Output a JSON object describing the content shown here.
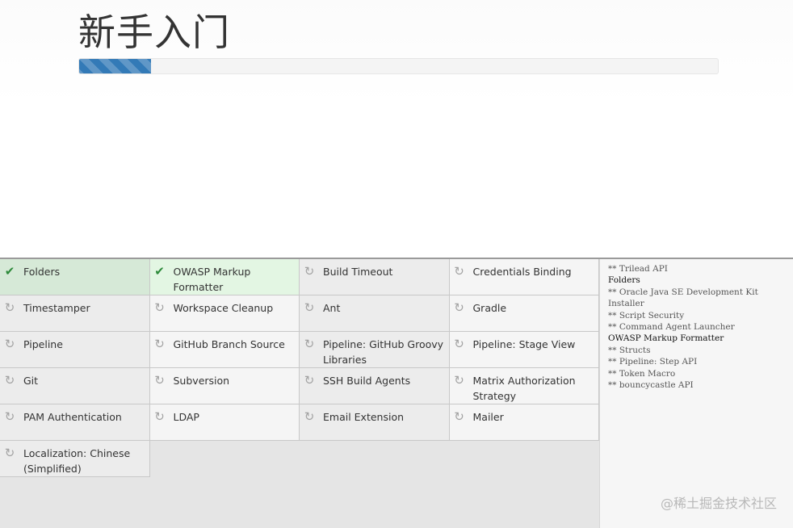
{
  "header": {
    "title": "新手入门",
    "progress_percent": 11.3
  },
  "plugin_rows": [
    [
      {
        "label": "Folders",
        "status": "success",
        "icon": "check-icon"
      },
      {
        "label": "OWASP Markup Formatter",
        "status": "success",
        "icon": "check-icon"
      },
      {
        "label": "Build Timeout",
        "status": "pending",
        "icon": "refresh-icon"
      },
      {
        "label": "Credentials Binding",
        "status": "pending",
        "icon": "refresh-icon"
      }
    ],
    [
      {
        "label": "Timestamper",
        "status": "pending",
        "icon": "refresh-icon"
      },
      {
        "label": "Workspace Cleanup",
        "status": "pending",
        "icon": "refresh-icon"
      },
      {
        "label": "Ant",
        "status": "pending",
        "icon": "refresh-icon"
      },
      {
        "label": "Gradle",
        "status": "pending",
        "icon": "refresh-icon"
      }
    ],
    [
      {
        "label": "Pipeline",
        "status": "pending",
        "icon": "refresh-icon"
      },
      {
        "label": "GitHub Branch Source",
        "status": "pending",
        "icon": "refresh-icon"
      },
      {
        "label": "Pipeline: GitHub Groovy Libraries",
        "status": "pending",
        "icon": "refresh-icon"
      },
      {
        "label": "Pipeline: Stage View",
        "status": "pending",
        "icon": "refresh-icon"
      }
    ],
    [
      {
        "label": "Git",
        "status": "pending",
        "icon": "refresh-icon"
      },
      {
        "label": "Subversion",
        "status": "pending",
        "icon": "refresh-icon"
      },
      {
        "label": "SSH Build Agents",
        "status": "pending",
        "icon": "refresh-icon"
      },
      {
        "label": "Matrix Authorization Strategy",
        "status": "pending",
        "icon": "refresh-icon"
      }
    ],
    [
      {
        "label": "PAM Authentication",
        "status": "pending",
        "icon": "refresh-icon"
      },
      {
        "label": "LDAP",
        "status": "pending",
        "icon": "refresh-icon"
      },
      {
        "label": "Email Extension",
        "status": "pending",
        "icon": "refresh-icon"
      },
      {
        "label": "Mailer",
        "status": "pending",
        "icon": "refresh-icon"
      }
    ],
    [
      {
        "label": "Localization: Chinese (Simplified)",
        "status": "pending",
        "icon": "refresh-icon"
      }
    ]
  ],
  "install_log": [
    {
      "text": "** Trilead API",
      "done": false
    },
    {
      "text": "Folders",
      "done": true
    },
    {
      "text": "** Oracle Java SE Development Kit Installer",
      "done": false
    },
    {
      "text": "** Script Security",
      "done": false
    },
    {
      "text": "** Command Agent Launcher",
      "done": false
    },
    {
      "text": "OWASP Markup Formatter",
      "done": true
    },
    {
      "text": "** Structs",
      "done": false
    },
    {
      "text": "** Pipeline: Step API",
      "done": false
    },
    {
      "text": "** Token Macro",
      "done": false
    },
    {
      "text": "** bouncycastle API",
      "done": false
    }
  ],
  "watermark": "@稀土掘金技术社区",
  "colors": {
    "progress": "#337ab7",
    "success_bg": "#d6e9d7",
    "success_icon": "#2d8a3a",
    "pending_icon": "#a3a3a3"
  }
}
